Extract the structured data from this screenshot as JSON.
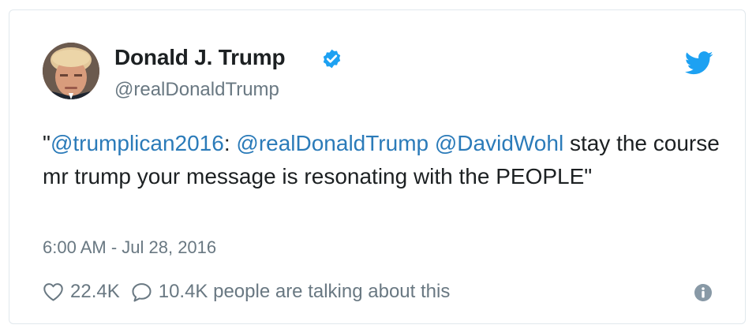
{
  "author": {
    "name": "Donald J. Trump",
    "handle": "@realDonaldTrump",
    "verified": true
  },
  "tweet": {
    "quote_open": "\"",
    "mention_1": "@trumplican2016",
    "sep_1": ": ",
    "mention_2": "@realDonaldTrump",
    "sep_2": " ",
    "mention_3": "@DavidWohl",
    "body": " stay the course mr trump your message is resonating with the PEOPLE\""
  },
  "timestamp": "6:00 AM - Jul 28, 2016",
  "actions": {
    "likes": "22.4K",
    "talking": "10.4K people are talking about this"
  },
  "icons": {
    "verified": "verified-badge-icon",
    "bird": "twitter-bird-icon",
    "heart": "heart-icon",
    "reply": "reply-bubble-icon",
    "info": "info-icon"
  },
  "colors": {
    "link": "#2b7bb9",
    "twitter_blue": "#1da1f2",
    "muted": "#697882",
    "text": "#1c2022",
    "border": "#e1e8ed"
  }
}
